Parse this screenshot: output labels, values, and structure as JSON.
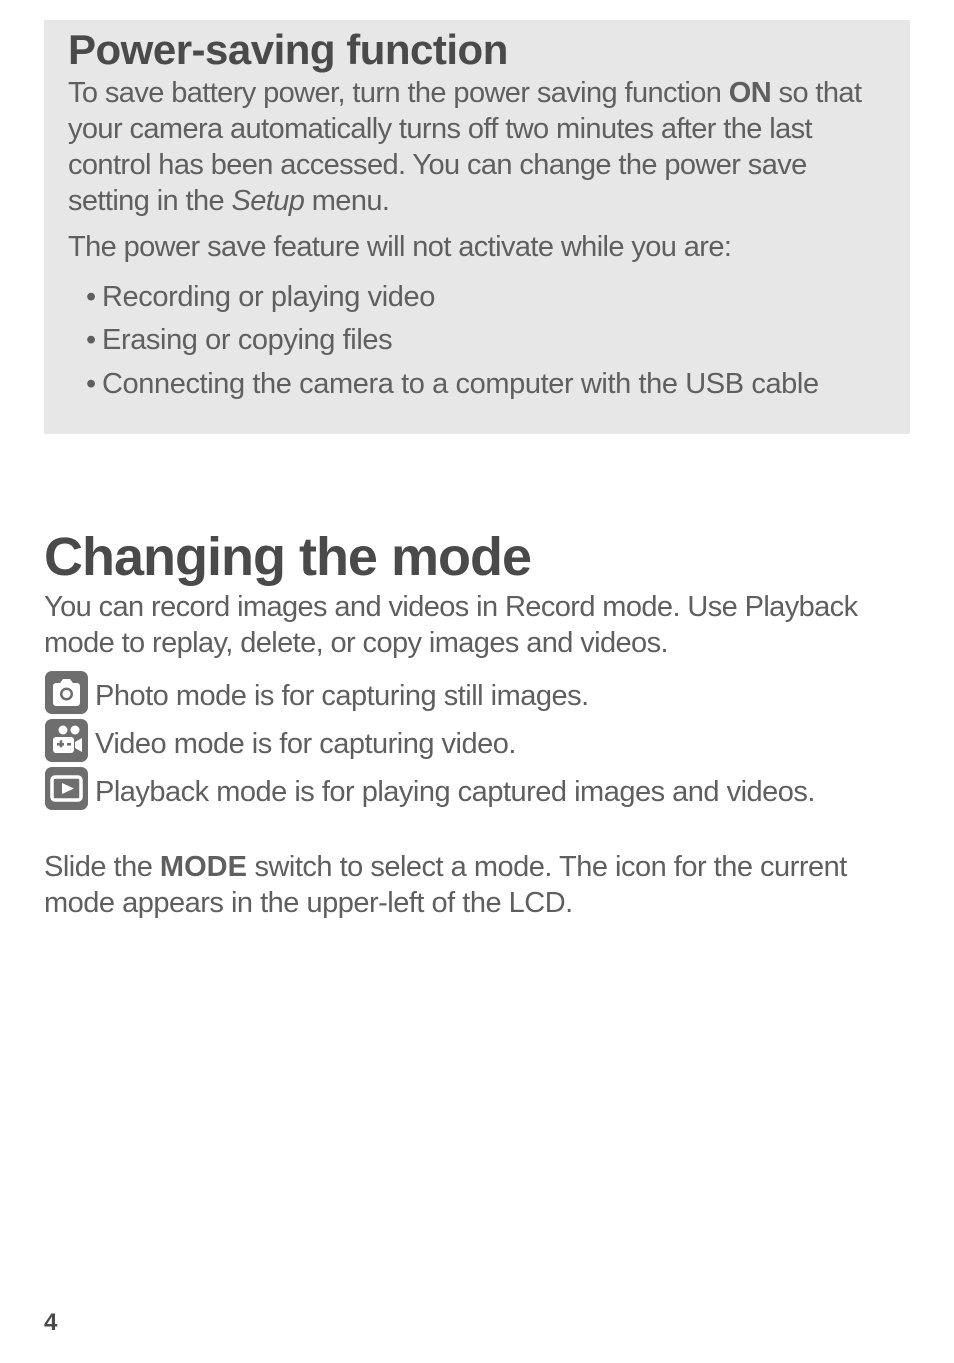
{
  "callout": {
    "heading": "Power-saving function",
    "p1_pre": "To save battery power, turn the power saving function ",
    "p1_bold": "ON",
    "p1_mid": " so that your camera automatically turns off two minutes after the last control has been accessed. You can change the power save setting in the ",
    "p1_italic": "Setup",
    "p1_post": " menu.",
    "p2": "The power save feature will not activate while you are:",
    "bullets": [
      "Recording or playing video",
      "Erasing or copying files",
      "Connecting the camera to a computer with the USB cable"
    ]
  },
  "section": {
    "heading": "Changing the mode",
    "intro": "You can record images and videos in Record mode. Use Playback mode to replay, delete, or copy images and videos.",
    "modes": [
      {
        "icon": "photo-icon",
        "text": "Photo mode is for capturing still images."
      },
      {
        "icon": "video-icon",
        "text": "Video mode is for capturing video."
      },
      {
        "icon": "playback-icon",
        "text": "Playback mode is for playing captured images and videos."
      }
    ],
    "tail_pre": "Slide the ",
    "tail_mode": "MODE",
    "tail_post": " switch to select a mode. The icon for the current mode appears in the upper-left of the LCD."
  },
  "page_number": "4"
}
